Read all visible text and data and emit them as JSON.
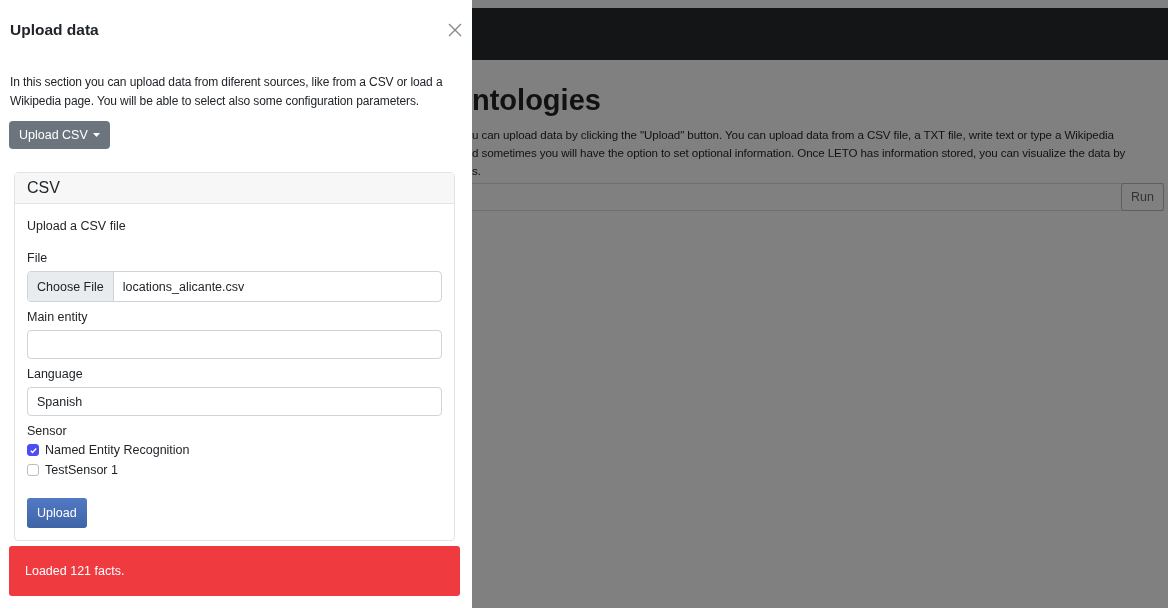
{
  "panel": {
    "title": "Upload data",
    "intro": "In this section you can upload data from diferent sources, like from a CSV or load a Wikipedia page. You will be able to select also some configuration parameters.",
    "dropdown": {
      "label": "Upload CSV"
    },
    "card": {
      "header": "CSV",
      "subtitle": "Upload a CSV file",
      "fields": [
        {
          "kind": "file",
          "label": "File",
          "button": "Choose File",
          "value": "locations_alicante.csv"
        },
        {
          "kind": "text",
          "label": "Main entity"
        },
        {
          "kind": "text",
          "label": "Language",
          "value": "Spanish"
        }
      ],
      "sensor_label": "Sensor",
      "sensors": [
        {
          "label": "Named Entity Recognition",
          "checked": true
        },
        {
          "label": "TestSensor 1",
          "checked": false
        }
      ],
      "submit": "Upload"
    },
    "alert": "Loaded 121 facts."
  },
  "background": {
    "heading": "ntologies",
    "lines": [
      "u can upload data by clicking the \"Upload\" button. You can upload data from a CSV file, a TXT file, write text or type a Wikipedia",
      "d sometimes you will have the option to set optional information. Once LETO has information stored, you can visualize the data by",
      "s."
    ],
    "run_button": "Run"
  }
}
